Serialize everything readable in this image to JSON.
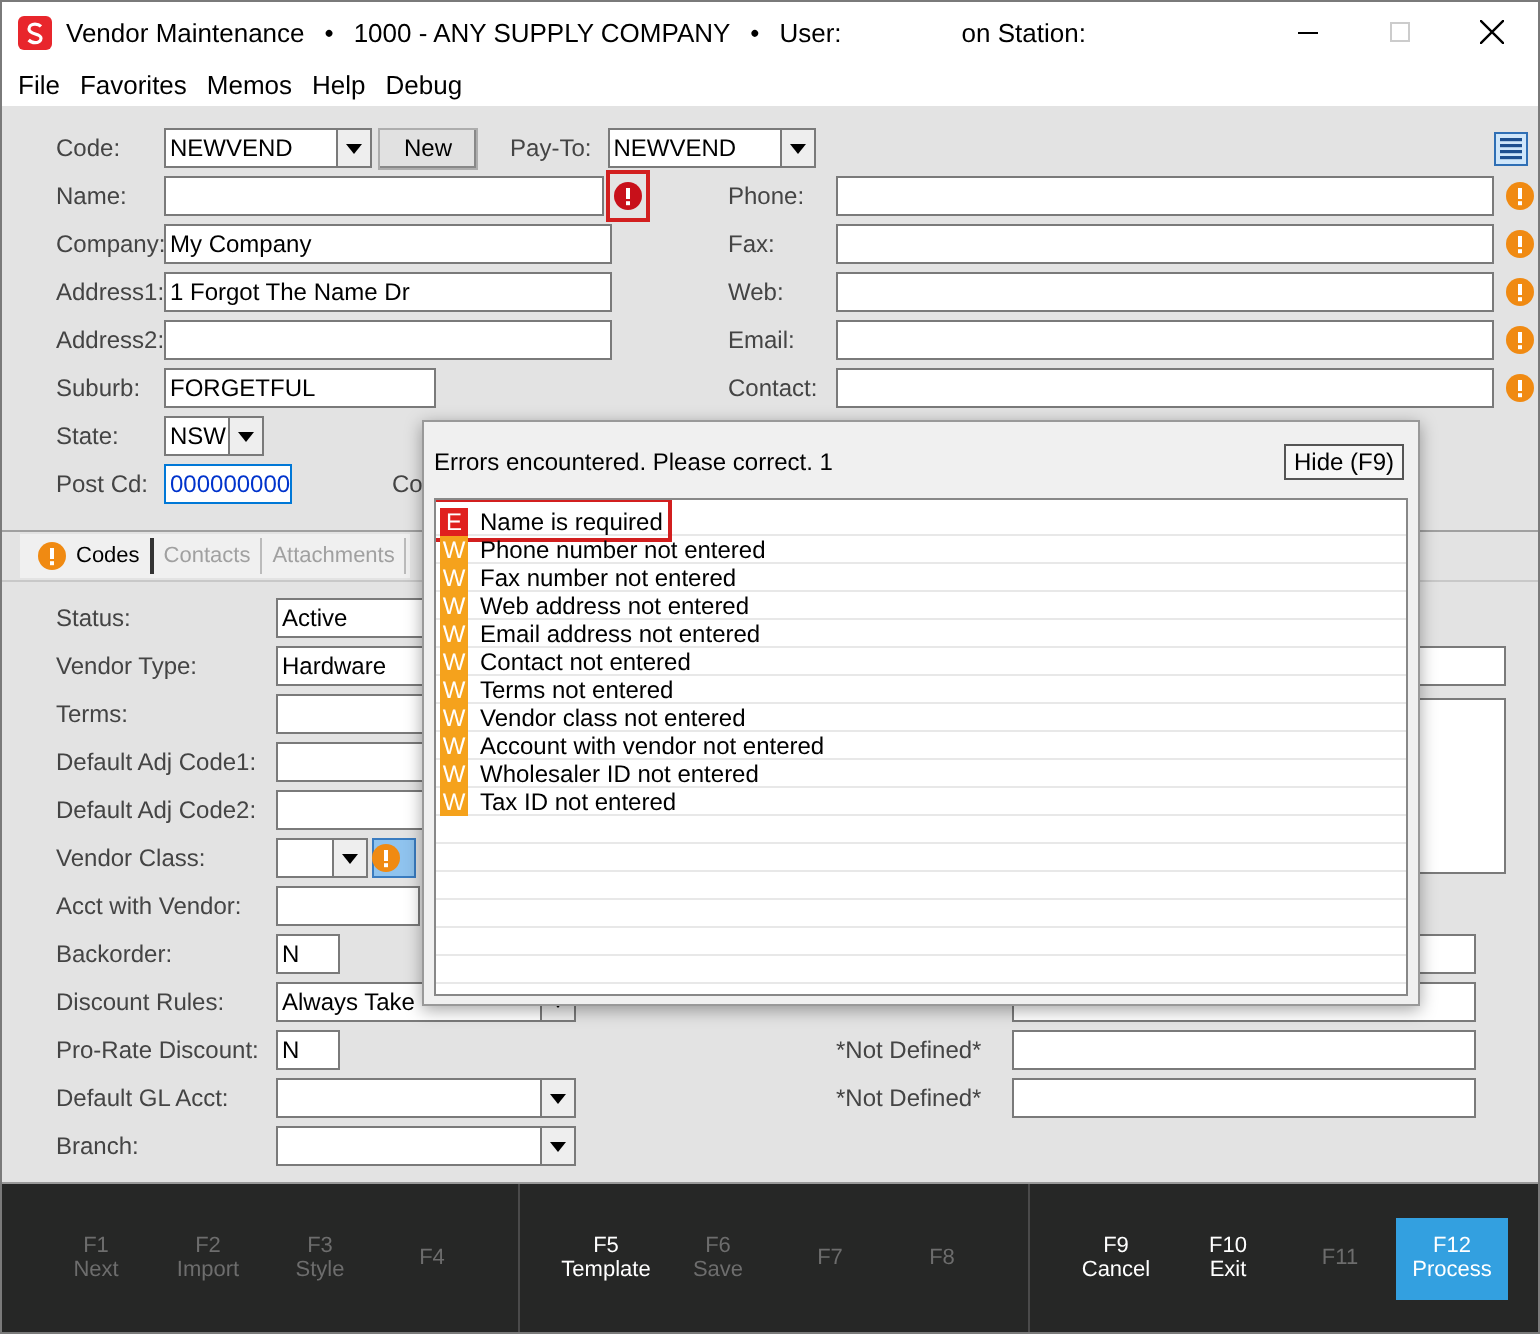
{
  "window": {
    "title_segments": [
      "Vendor Maintenance",
      "•",
      "1000 - ANY SUPPLY COMPANY",
      "•",
      "User:",
      "on Station:"
    ],
    "maximize_disabled": true
  },
  "menu": [
    "File",
    "Favorites",
    "Memos",
    "Help",
    "Debug"
  ],
  "header_left": [
    {
      "label": "Code:",
      "kind": "code",
      "value": "NEWVEND",
      "button": "New",
      "payto_label": "Pay-To:",
      "payto_value": "NEWVEND"
    },
    {
      "label": "Name:",
      "kind": "text",
      "error": true
    },
    {
      "label": "Company:",
      "kind": "text",
      "value": "My Company"
    },
    {
      "label": "Address1:",
      "kind": "text",
      "value": "1 Forgot The Name Dr"
    },
    {
      "label": "Address2:",
      "kind": "text"
    },
    {
      "label": "Suburb:",
      "kind": "short",
      "value": "FORGETFUL"
    },
    {
      "label": "State:",
      "kind": "combo",
      "value": "NSW"
    },
    {
      "label": "Post Cd:",
      "kind": "post",
      "value": "000000000",
      "extra_label": "Co"
    }
  ],
  "header_right": [
    {
      "label": "Phone:",
      "warning": true
    },
    {
      "label": "Fax:",
      "warning": true
    },
    {
      "label": "Web:",
      "warning": true
    },
    {
      "label": "Email:",
      "warning": true
    },
    {
      "label": "Contact:",
      "warning": true
    }
  ],
  "tabs": [
    {
      "label": "Codes",
      "selected": true,
      "warning": true
    },
    {
      "label": "Contacts",
      "selected": false,
      "warning": false
    },
    {
      "label": "Attachments",
      "selected": false,
      "warning": false
    }
  ],
  "codes_left": [
    {
      "label": "Status:",
      "kind": "wide",
      "value": "Active"
    },
    {
      "label": "Vendor Type:",
      "kind": "wide",
      "value": "Hardware"
    },
    {
      "label": "Terms:",
      "kind": "wide"
    },
    {
      "label": "Default Adj Code1:",
      "kind": "wide"
    },
    {
      "label": "Default Adj Code2:",
      "kind": "wide"
    },
    {
      "label": "Vendor Class:",
      "kind": "class",
      "warning": true
    },
    {
      "label": "Acct with Vendor:",
      "kind": "medium"
    },
    {
      "label": "Backorder:",
      "kind": "tiny",
      "value": "N"
    },
    {
      "label": "Discount Rules:",
      "kind": "combo",
      "value": "Always Take"
    },
    {
      "label": "Pro-Rate Discount:",
      "kind": "tiny",
      "value": "N"
    },
    {
      "label": "Default GL Acct:",
      "kind": "combo"
    },
    {
      "label": "Branch:",
      "kind": "combo"
    }
  ],
  "codes_right": [
    {
      "kind": "gap"
    },
    {
      "kind": "field"
    },
    {
      "kind": "memo"
    },
    {
      "kind": "gap"
    },
    {
      "kind": "narrow"
    },
    {
      "kind": "narrow"
    },
    {
      "kind": "labeled",
      "label": "*Not Defined*"
    },
    {
      "kind": "labeled",
      "label": "*Not Defined*"
    }
  ],
  "errors_popup": {
    "title": "Errors encountered. Please correct. 1",
    "hide_button": "Hide (F9)",
    "items": [
      {
        "kind": "error",
        "badge": "E",
        "text": "Name is required",
        "highlighted": true
      },
      {
        "kind": "warning",
        "badge": "W",
        "text": "Phone number not entered",
        "highlighted": false
      },
      {
        "kind": "warning",
        "badge": "W",
        "text": "Fax number not entered",
        "highlighted": false
      },
      {
        "kind": "warning",
        "badge": "W",
        "text": "Web address not entered",
        "highlighted": false
      },
      {
        "kind": "warning",
        "badge": "W",
        "text": "Email address not entered",
        "highlighted": false
      },
      {
        "kind": "warning",
        "badge": "W",
        "text": "Contact not entered",
        "highlighted": false
      },
      {
        "kind": "warning",
        "badge": "W",
        "text": "Terms not entered",
        "highlighted": false
      },
      {
        "kind": "warning",
        "badge": "W",
        "text": "Vendor class not entered",
        "highlighted": false
      },
      {
        "kind": "warning",
        "badge": "W",
        "text": "Account with vendor not entered",
        "highlighted": false
      },
      {
        "kind": "warning",
        "badge": "W",
        "text": "Wholesaler ID not entered",
        "highlighted": false
      },
      {
        "kind": "warning",
        "badge": "W",
        "text": "Tax ID not entered",
        "highlighted": false
      }
    ]
  },
  "function_keys": [
    {
      "key": "F1",
      "label": "Next",
      "enabled": false,
      "primary": false
    },
    {
      "key": "F2",
      "label": "Import",
      "enabled": false,
      "primary": false
    },
    {
      "key": "F3",
      "label": "Style",
      "enabled": false,
      "primary": false
    },
    {
      "key": "F4",
      "enabled": false,
      "primary": false
    },
    {
      "key": "F5",
      "label": "Template",
      "enabled": true,
      "primary": false
    },
    {
      "key": "F6",
      "label": "Save",
      "enabled": false,
      "primary": false
    },
    {
      "key": "F7",
      "enabled": false,
      "primary": false
    },
    {
      "key": "F8",
      "enabled": false,
      "primary": false
    },
    {
      "key": "F9",
      "label": "Cancel",
      "enabled": true,
      "primary": false
    },
    {
      "key": "F10",
      "label": "Exit",
      "enabled": true,
      "primary": false
    },
    {
      "key": "F11",
      "enabled": false,
      "primary": false
    },
    {
      "key": "F12",
      "label": "Process",
      "enabled": true,
      "primary": true
    }
  ]
}
